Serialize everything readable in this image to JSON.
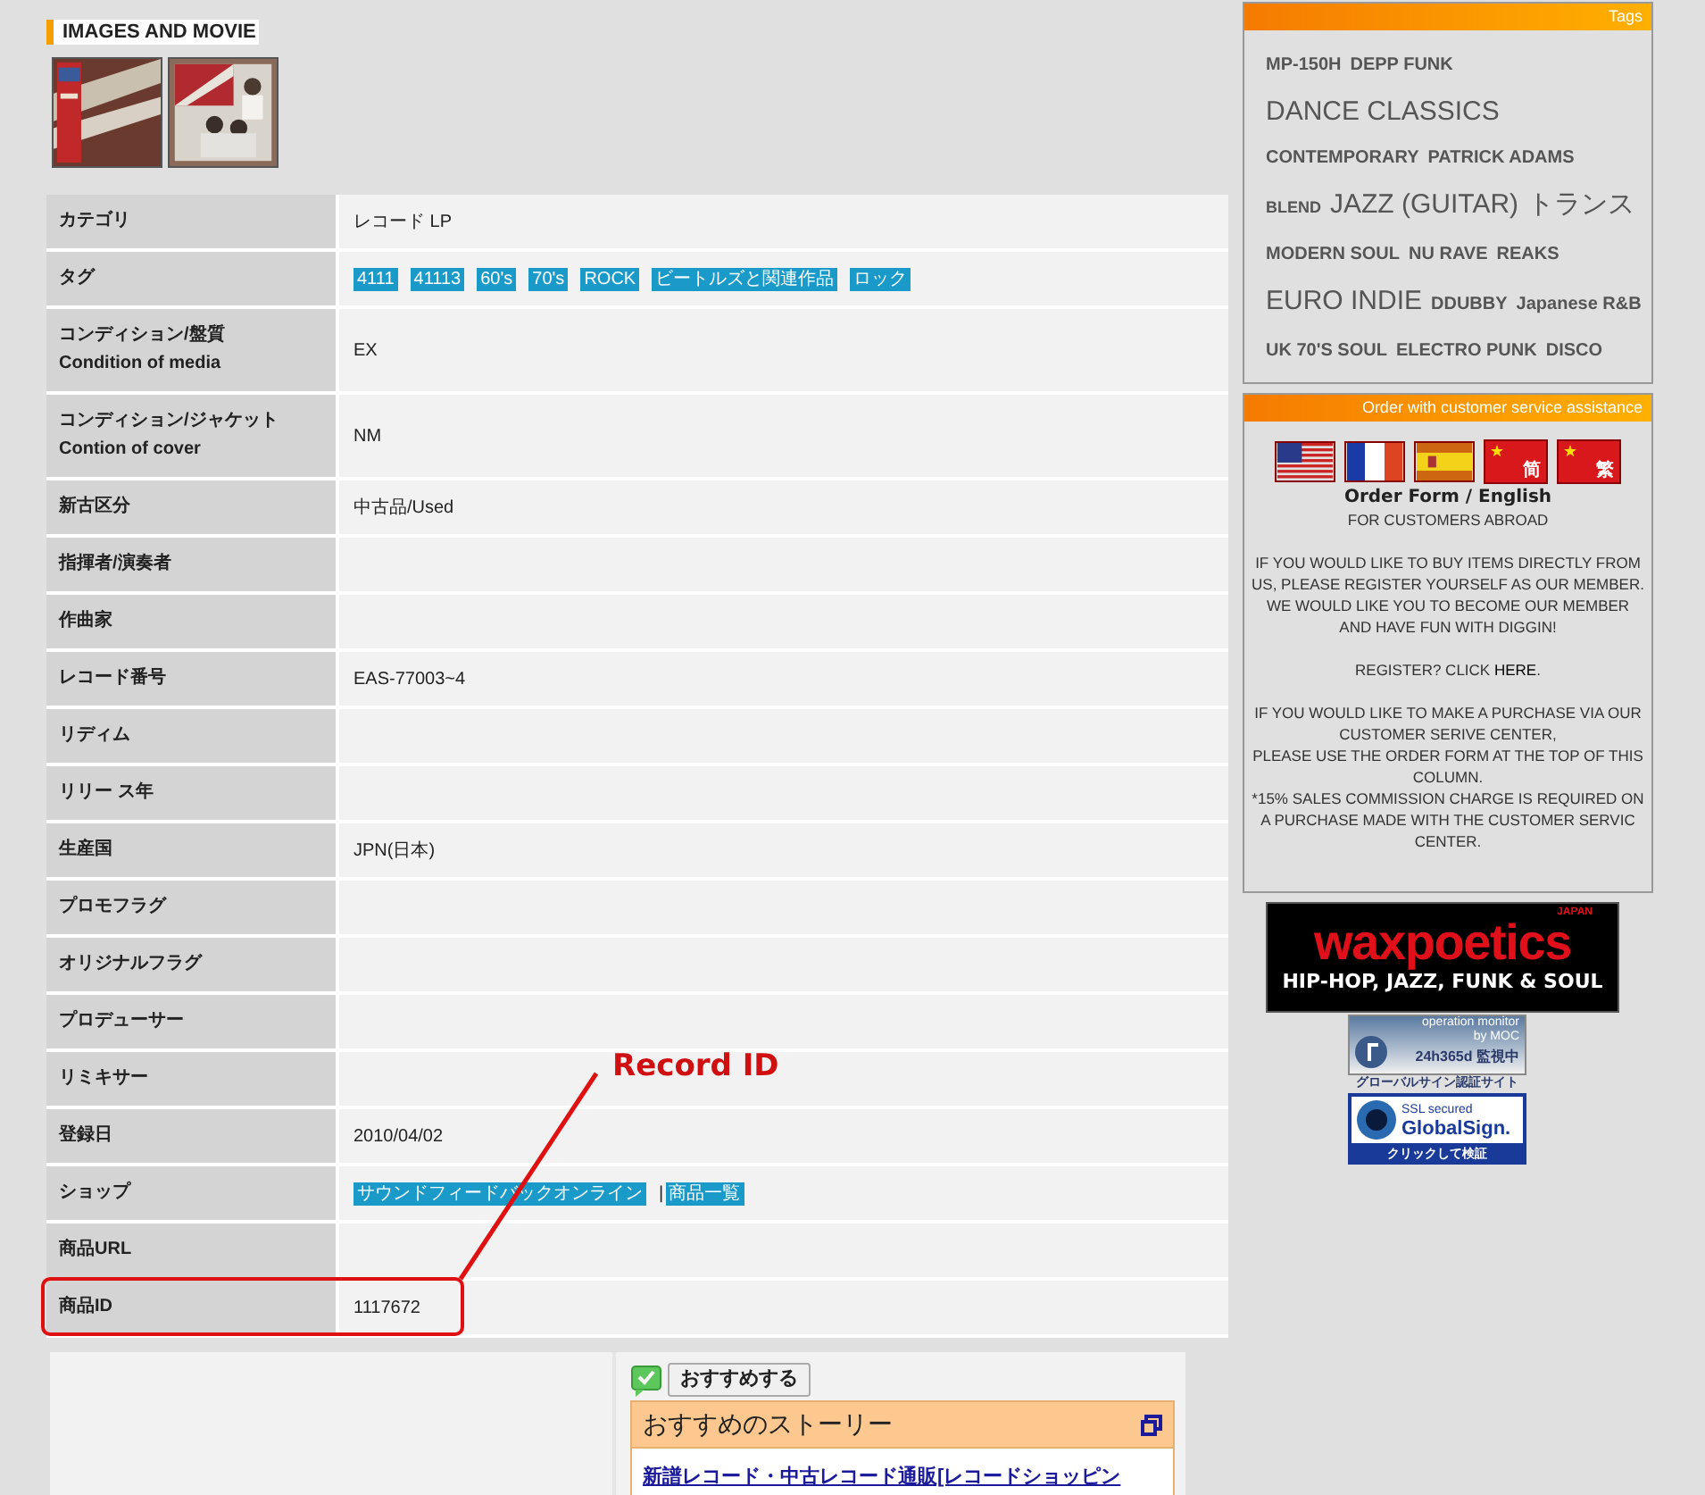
{
  "section_title": "IMAGES AND MOVIE",
  "rows": [
    {
      "label": [
        "カテゴリ"
      ],
      "kind": "text",
      "value": "レコード LP",
      "highlighted": false
    },
    {
      "label": [
        "タグ"
      ],
      "kind": "tags",
      "tags": [
        "4111",
        "41113",
        "60's",
        "70's",
        "ROCK",
        "ビートルズと関連作品",
        "ロック"
      ],
      "highlighted": false
    },
    {
      "label": [
        "コンディション/盤質",
        "Condition of media"
      ],
      "kind": "text",
      "value": "EX",
      "highlighted": false
    },
    {
      "label": [
        "コンディション/ジャケット",
        "Contion of cover"
      ],
      "kind": "text",
      "value": "NM",
      "highlighted": false
    },
    {
      "label": [
        "新古区分"
      ],
      "kind": "text",
      "value": "中古品/Used",
      "highlighted": false
    },
    {
      "label": [
        "指揮者/演奏者"
      ],
      "kind": "text",
      "value": "",
      "highlighted": false
    },
    {
      "label": [
        "作曲家"
      ],
      "kind": "text",
      "value": "",
      "highlighted": false
    },
    {
      "label": [
        "レコード番号"
      ],
      "kind": "text",
      "value": "EAS-77003~4",
      "highlighted": false
    },
    {
      "label": [
        "リディム"
      ],
      "kind": "text",
      "value": "",
      "highlighted": false
    },
    {
      "label": [
        "リリー ス年"
      ],
      "kind": "text",
      "value": "",
      "highlighted": false
    },
    {
      "label": [
        "生産国"
      ],
      "kind": "text",
      "value": "JPN(日本)",
      "highlighted": false
    },
    {
      "label": [
        "プロモフラグ"
      ],
      "kind": "text",
      "value": "",
      "highlighted": false
    },
    {
      "label": [
        "オリジナルフラグ"
      ],
      "kind": "text",
      "value": "",
      "highlighted": false
    },
    {
      "label": [
        "プロデューサー"
      ],
      "kind": "text",
      "value": "",
      "highlighted": false
    },
    {
      "label": [
        "リミキサー"
      ],
      "kind": "text",
      "value": "",
      "highlighted": false
    },
    {
      "label": [
        "登録日"
      ],
      "kind": "text",
      "value": "2010/04/02",
      "highlighted": false
    },
    {
      "label": [
        "ショップ"
      ],
      "kind": "links",
      "links": [
        "サウンドフィードバックオンライン",
        "商品一覧"
      ],
      "separator": "|",
      "highlighted": false
    },
    {
      "label": [
        "商品URL"
      ],
      "kind": "text",
      "value": "",
      "highlighted": false
    },
    {
      "label": [
        "商品ID"
      ],
      "kind": "text",
      "value": "1117672",
      "highlighted": true
    }
  ],
  "annotation": "Record ID",
  "recommend": {
    "button": "おすすめする",
    "panel_title": "おすすめのストーリー",
    "link": "新譜レコード・中古レコード通販[レコードショッピン"
  },
  "tags_box": {
    "title": "Tags",
    "lines": [
      [
        {
          "text": "MP-150H",
          "kind": "small"
        },
        {
          "text": "DEPP FUNK",
          "kind": "small"
        }
      ],
      [
        {
          "text": "DANCE CLASSICS",
          "kind": "large"
        }
      ],
      [
        {
          "text": "CONTEMPORARY",
          "kind": "small"
        },
        {
          "text": "PATRICK ADAMS",
          "kind": "small"
        }
      ],
      [
        {
          "text": "BLEND",
          "kind": "tiny"
        },
        {
          "text": "JAZZ (GUITAR)",
          "kind": "large"
        },
        {
          "text": "トランス",
          "kind": "large"
        }
      ],
      [
        {
          "text": "MODERN SOUL",
          "kind": "small"
        },
        {
          "text": "NU RAVE",
          "kind": "small"
        },
        {
          "text": "REAKS",
          "kind": "small"
        }
      ],
      [
        {
          "text": "EURO INDIE",
          "kind": "large"
        },
        {
          "text": "DDUBBY",
          "kind": "small"
        },
        {
          "text": "Japanese R&B",
          "kind": "small"
        }
      ],
      [
        {
          "text": "UK 70'S SOUL",
          "kind": "small"
        },
        {
          "text": "ELECTRO PUNK",
          "kind": "small"
        },
        {
          "text": "DISCO",
          "kind": "small"
        }
      ]
    ]
  },
  "order_box": {
    "title": "Order with customer service assistance",
    "flags": [
      {
        "kind": "us"
      },
      {
        "kind": "fr"
      },
      {
        "kind": "es"
      },
      {
        "kind": "cn",
        "mark": "简"
      },
      {
        "kind": "cn",
        "mark": "繁"
      }
    ],
    "form_link": "Order Form / English",
    "subtitle": "FOR CUSTOMERS ABROAD",
    "paragraphs": [
      "IF YOU WOULD LIKE TO BUY ITEMS DIRECTLY FROM US, PLEASE REGISTER YOURSELF AS OUR MEMBER.",
      "WE WOULD LIKE YOU TO BECOME OUR MEMBER AND HAVE FUN WITH DIGGIN!"
    ],
    "register": {
      "text": "REGISTER? CLICK",
      "link": "HERE",
      "end": "."
    },
    "paragraphs2": [
      "IF YOU WOULD LIKE TO MAKE A PURCHASE VIA OUR CUSTOMER SERIVE CENTER,",
      "PLEASE USE THE ORDER FORM AT THE TOP OF THIS COLUMN.",
      "*15% SALES COMMISSION CHARGE IS REQUIRED ON A PURCHASE MADE WITH THE CUSTOMER SERVIC CENTER."
    ]
  },
  "banners": {
    "wax": {
      "name": "waxpoetics",
      "region": "JAPAN",
      "tagline": "HIP-HOP, JAZZ, FUNK & SOUL"
    },
    "monitor": {
      "top": "operation monitor",
      "by": "by MOC",
      "main": "24h365d 監視中",
      "caption": "グローバルサイン認証サイト"
    },
    "ssl": {
      "top": "SSL secured",
      "brand": "GlobalSign.",
      "caption": "クリックして検証"
    }
  }
}
